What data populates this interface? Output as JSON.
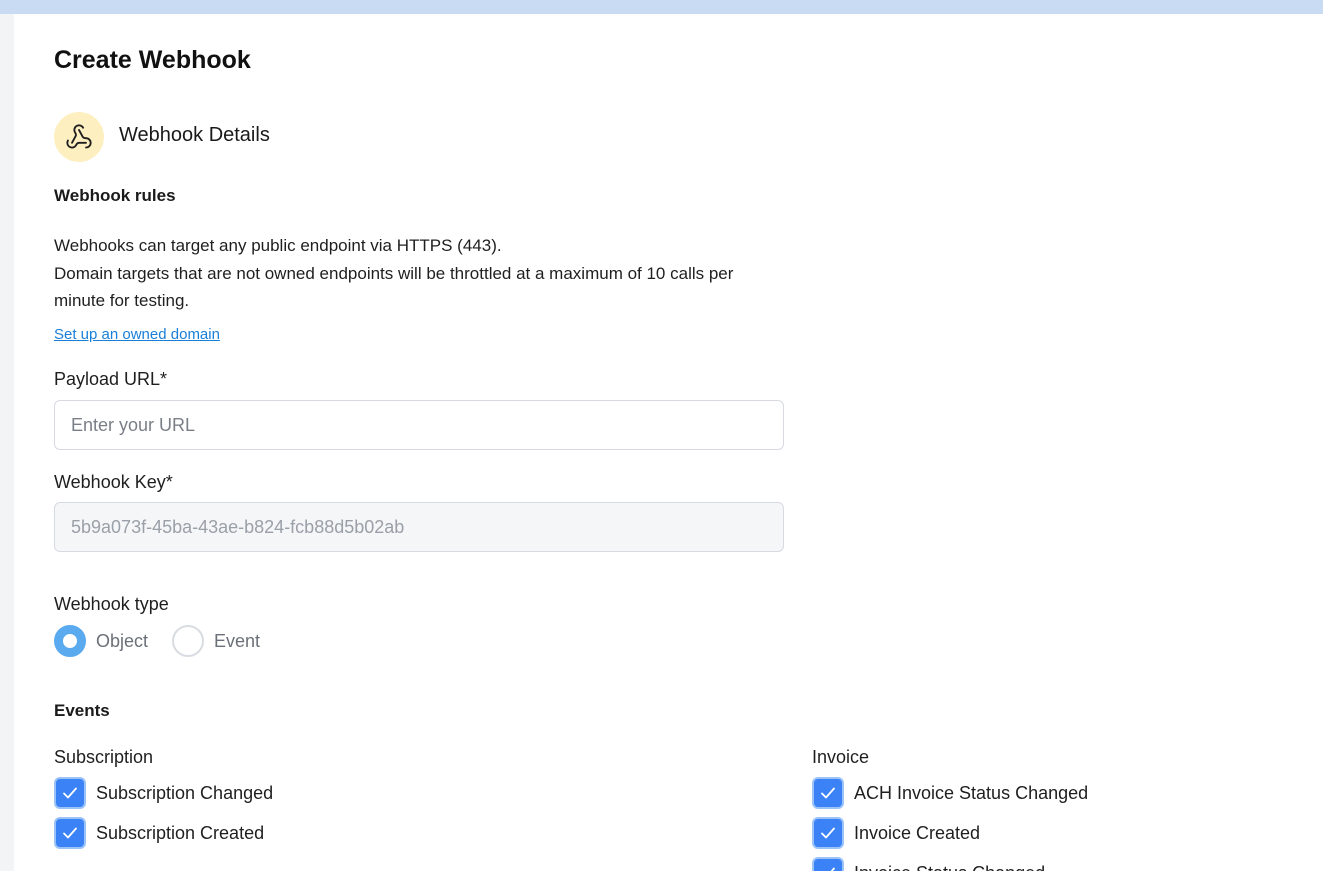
{
  "page": {
    "title": "Create Webhook"
  },
  "details": {
    "section_title": "Webhook Details",
    "icon": "webhook-icon"
  },
  "rules": {
    "heading": "Webhook rules",
    "line1": "Webhooks can target any public endpoint via HTTPS (443).",
    "line2": "Domain targets that are not owned endpoints will be throttled at a maximum of 10 calls per minute for testing.",
    "link": "Set up an owned domain"
  },
  "payload_url": {
    "label": "Payload URL*",
    "placeholder": "Enter your URL",
    "value": ""
  },
  "webhook_key": {
    "label": "Webhook Key*",
    "value": "5b9a073f-45ba-43ae-b824-fcb88d5b02ab"
  },
  "webhook_type": {
    "label": "Webhook type",
    "options": [
      {
        "label": "Object",
        "selected": true
      },
      {
        "label": "Event",
        "selected": false
      }
    ]
  },
  "events": {
    "heading": "Events",
    "subscription": {
      "label": "Subscription",
      "items": [
        {
          "label": "Subscription Changed",
          "checked": true
        },
        {
          "label": "Subscription Created",
          "checked": true
        }
      ]
    },
    "invoice": {
      "label": "Invoice",
      "items": [
        {
          "label": "ACH Invoice Status Changed",
          "checked": true
        },
        {
          "label": "Invoice Created",
          "checked": true
        },
        {
          "label": "Invoice Status Changed",
          "checked": true
        }
      ]
    }
  },
  "colors": {
    "accent": "#3b82f6",
    "link": "#1a7fd8",
    "icon_bg": "#fdefc0",
    "top_bar": "#c9dbf3"
  }
}
